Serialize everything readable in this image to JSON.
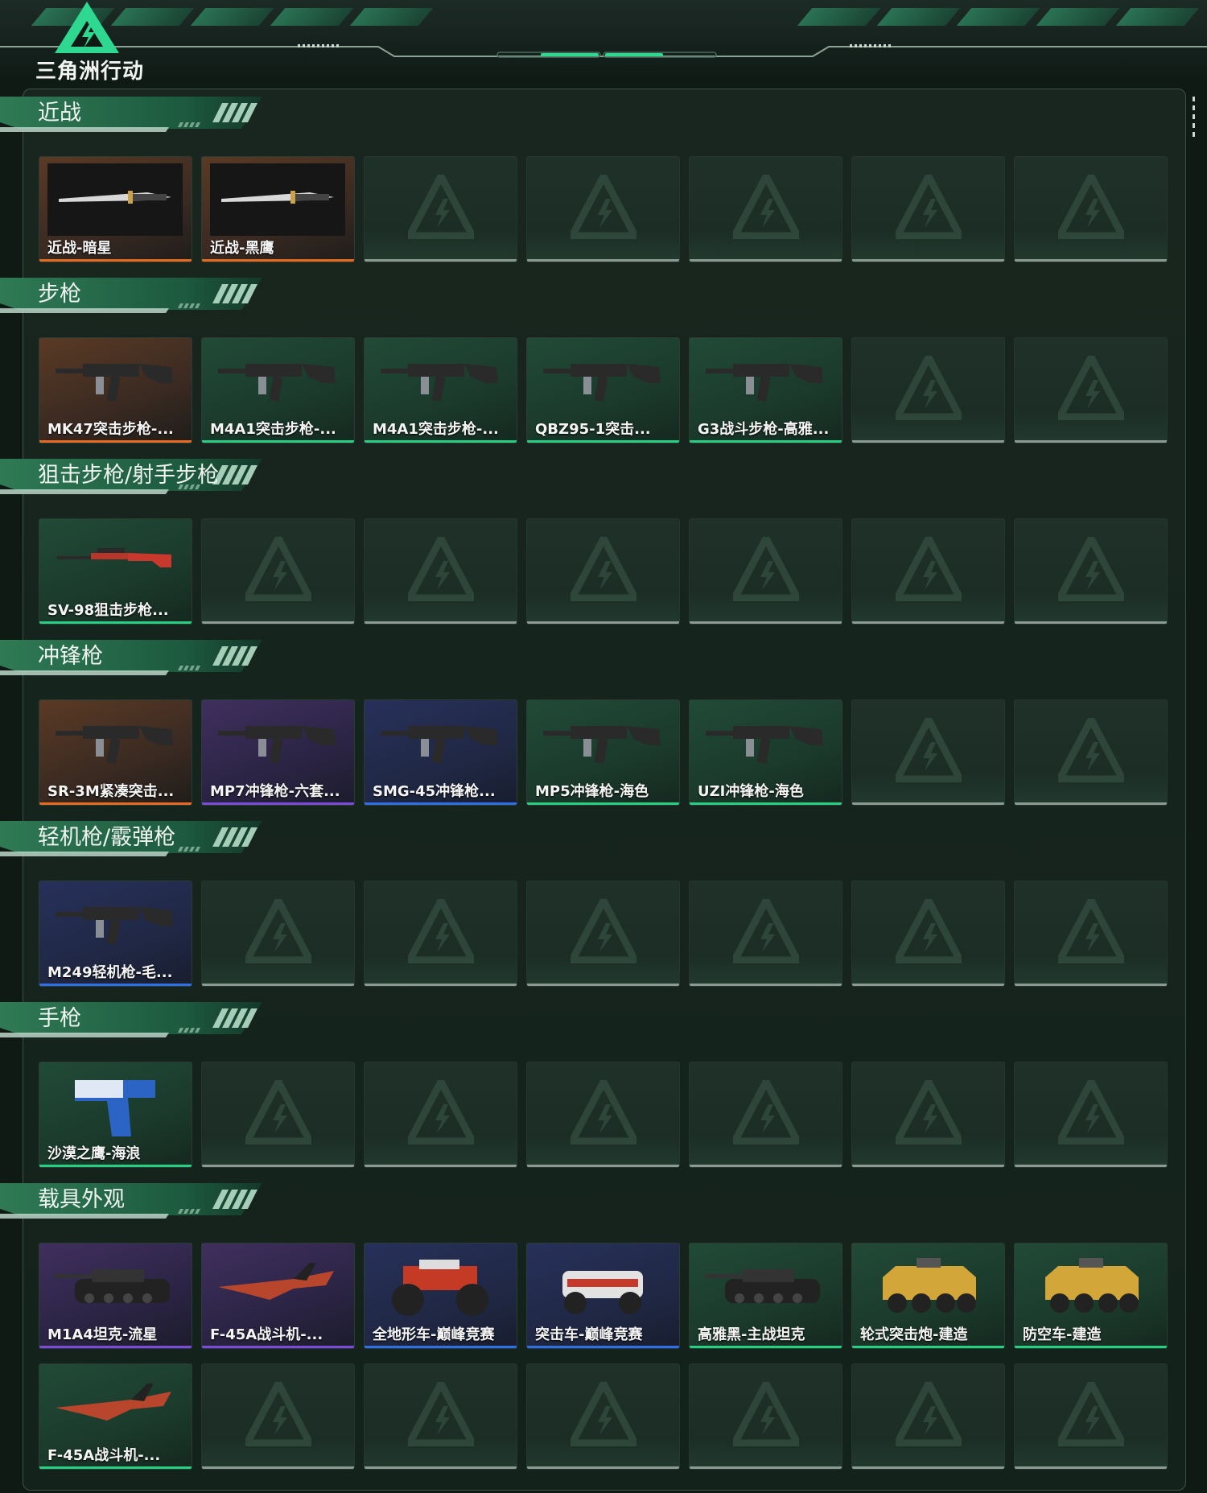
{
  "header": {
    "logo_text": "三角洲行动"
  },
  "colors": {
    "accent": "#27cf83",
    "rarity_orange": "#e76a1e",
    "rarity_purple": "#7c4bdc",
    "rarity_blue": "#2f6fe8",
    "rarity_green": "#27cf83",
    "empty_bar": "#8c9a94"
  },
  "sections": [
    {
      "title": "近战",
      "items": [
        {
          "label": "近战-暗星",
          "rarity": "orange",
          "icon": "knife-icon"
        },
        {
          "label": "近战-黑鹰",
          "rarity": "orange",
          "icon": "knife-icon"
        }
      ]
    },
    {
      "title": "步枪",
      "items": [
        {
          "label": "MK47突击步枪-...",
          "rarity": "orange",
          "icon": "rifle-icon"
        },
        {
          "label": "M4A1突击步枪-...",
          "rarity": "green",
          "icon": "rifle-icon"
        },
        {
          "label": "M4A1突击步枪-...",
          "rarity": "green",
          "icon": "rifle-icon"
        },
        {
          "label": "QBZ95-1突击...",
          "rarity": "green",
          "icon": "rifle-icon"
        },
        {
          "label": "G3战斗步枪-高雅...",
          "rarity": "green",
          "icon": "rifle-icon"
        }
      ]
    },
    {
      "title": "狙击步枪/射手步枪",
      "items": [
        {
          "label": "SV-98狙击步枪...",
          "rarity": "green",
          "icon": "sniper-icon"
        }
      ]
    },
    {
      "title": "冲锋枪",
      "items": [
        {
          "label": "SR-3M紧凑突击...",
          "rarity": "orange",
          "icon": "smg-icon"
        },
        {
          "label": "MP7冲锋枪-六套...",
          "rarity": "purple",
          "icon": "smg-icon"
        },
        {
          "label": "SMG-45冲锋枪...",
          "rarity": "blue",
          "icon": "smg-icon"
        },
        {
          "label": "MP5冲锋枪-海色",
          "rarity": "green",
          "icon": "smg-icon"
        },
        {
          "label": "UZI冲锋枪-海色",
          "rarity": "green",
          "icon": "smg-icon"
        }
      ]
    },
    {
      "title": "轻机枪/霰弹枪",
      "items": [
        {
          "label": "M249轻机枪-毛...",
          "rarity": "blue",
          "icon": "lmg-icon"
        }
      ]
    },
    {
      "title": "手枪",
      "items": [
        {
          "label": "沙漠之鹰-海浪",
          "rarity": "green",
          "icon": "pistol-icon"
        }
      ]
    },
    {
      "title": "载具外观",
      "items": [
        {
          "label": "M1A4坦克-流星",
          "rarity": "purple",
          "icon": "tank-icon"
        },
        {
          "label": "F-45A战斗机-...",
          "rarity": "purple",
          "icon": "jet-icon"
        },
        {
          "label": "全地形车-巅峰竞赛",
          "rarity": "blue",
          "icon": "atv-icon"
        },
        {
          "label": "突击车-巅峰竞赛",
          "rarity": "blue",
          "icon": "buggy-icon"
        },
        {
          "label": "高雅黑-主战坦克",
          "rarity": "green",
          "icon": "tank-icon"
        },
        {
          "label": "轮式突击炮-建造",
          "rarity": "green",
          "icon": "armored-vehicle-icon"
        },
        {
          "label": "防空车-建造",
          "rarity": "green",
          "icon": "armored-vehicle-icon"
        },
        {
          "label": "F-45A战斗机-...",
          "rarity": "green",
          "icon": "jet-icon"
        }
      ]
    }
  ]
}
